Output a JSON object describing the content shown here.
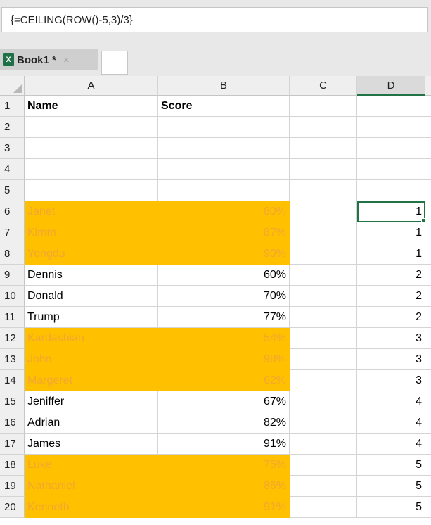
{
  "formula_bar": {
    "formula": "{=CEILING(ROW()-5,3)/3}"
  },
  "tab": {
    "title": "Book1 *",
    "close_glyph": "×",
    "icon": "excel-icon",
    "icon_letter": "X"
  },
  "colors": {
    "highlight": "#ffc000",
    "selection": "#217346"
  },
  "columns": [
    "A",
    "B",
    "C",
    "D"
  ],
  "rows": [
    {
      "num": "1",
      "a": "Name",
      "b": "Score",
      "d": "",
      "bold": true,
      "hl": false
    },
    {
      "num": "2",
      "a": "",
      "b": "",
      "d": "",
      "hl": false
    },
    {
      "num": "3",
      "a": "",
      "b": "",
      "d": "",
      "hl": false
    },
    {
      "num": "4",
      "a": "",
      "b": "",
      "d": "",
      "hl": false
    },
    {
      "num": "5",
      "a": "",
      "b": "",
      "d": "",
      "hl": false
    },
    {
      "num": "6",
      "a": "Janet",
      "b": "80%",
      "d": "1",
      "hl": true,
      "selected": true
    },
    {
      "num": "7",
      "a": "Kimm",
      "b": "87%",
      "d": "1",
      "hl": true
    },
    {
      "num": "8",
      "a": "Yongdu",
      "b": "90%",
      "d": "1",
      "hl": true
    },
    {
      "num": "9",
      "a": "Dennis",
      "b": "60%",
      "d": "2",
      "hl": false
    },
    {
      "num": "10",
      "a": "Donald",
      "b": "70%",
      "d": "2",
      "hl": false
    },
    {
      "num": "11",
      "a": "Trump",
      "b": "77%",
      "d": "2",
      "hl": false
    },
    {
      "num": "12",
      "a": "Kardashian",
      "b": "54%",
      "d": "3",
      "hl": true
    },
    {
      "num": "13",
      "a": "John",
      "b": "98%",
      "d": "3",
      "hl": true
    },
    {
      "num": "14",
      "a": "Margeret",
      "b": "62%",
      "d": "3",
      "hl": true
    },
    {
      "num": "15",
      "a": "Jeniffer",
      "b": "67%",
      "d": "4",
      "hl": false
    },
    {
      "num": "16",
      "a": "Adrian",
      "b": "82%",
      "d": "4",
      "hl": false
    },
    {
      "num": "17",
      "a": "James",
      "b": "91%",
      "d": "4",
      "hl": false
    },
    {
      "num": "18",
      "a": "Luke",
      "b": "75%",
      "d": "5",
      "hl": true
    },
    {
      "num": "19",
      "a": "Nathaniel",
      "b": "86%",
      "d": "5",
      "hl": true
    },
    {
      "num": "20",
      "a": "Kenneth",
      "b": "91%",
      "d": "5",
      "hl": true
    }
  ]
}
